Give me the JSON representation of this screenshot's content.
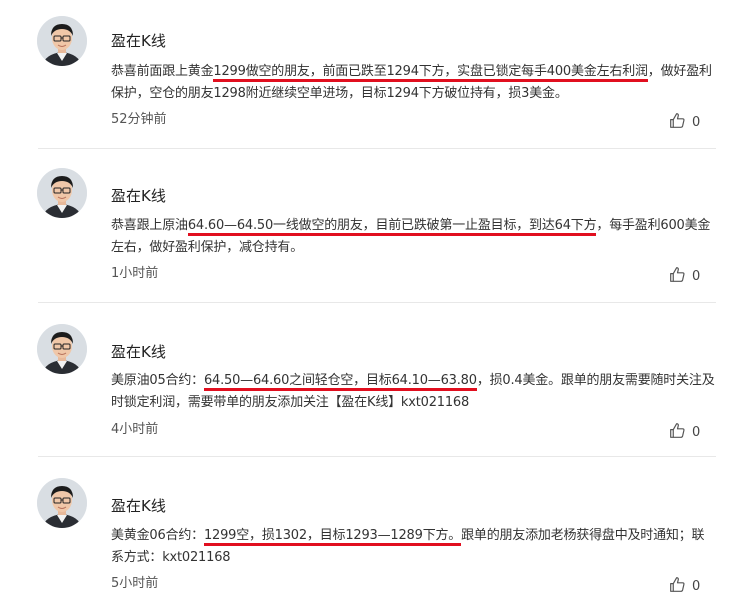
{
  "posts": [
    {
      "author": "盈在K线",
      "time": "52分钟前",
      "likes": "0",
      "text_pre": "恭喜前面跟上黄金",
      "text_hl": "1299做空的朋友，前面已跌至1294下方，实盘已锁定每手400美金左右利润",
      "text_post": "，做好盈利保护，空仓的朋友1298附近继续空单进场，目标1294下方破位持有，损3美金。"
    },
    {
      "author": "盈在K线",
      "time": "1小时前",
      "likes": "0",
      "text_pre": "恭喜跟上原油",
      "text_hl": "64.60—64.50一线做空的朋友，目前已跌破第一止盈目标，到达64下方",
      "text_post": "，每手盈利600美金左右，做好盈利保护，减仓持有。"
    },
    {
      "author": "盈在K线",
      "time": "4小时前",
      "likes": "0",
      "text_pre": "美原油05合约：",
      "text_hl": "64.50—64.60之间轻仓空，目标64.10—63.80",
      "text_post": "，损0.4美金。跟单的朋友需要随时关注及时锁定利润，需要带单的朋友添加关注【盈在K线】kxt021168"
    },
    {
      "author": "盈在K线",
      "time": "5小时前",
      "likes": "0",
      "text_pre": "美黄金06合约：",
      "text_hl": "1299空，损1302，目标1293—1289下方。",
      "text_post": "跟单的朋友添加老杨获得盘中及时通知；联系方式：kxt021168"
    }
  ],
  "icons": {
    "avatar": "avatar-man-glasses",
    "like": "thumbs-up-icon"
  },
  "colors": {
    "highlight_underline": "#e10f1f"
  }
}
